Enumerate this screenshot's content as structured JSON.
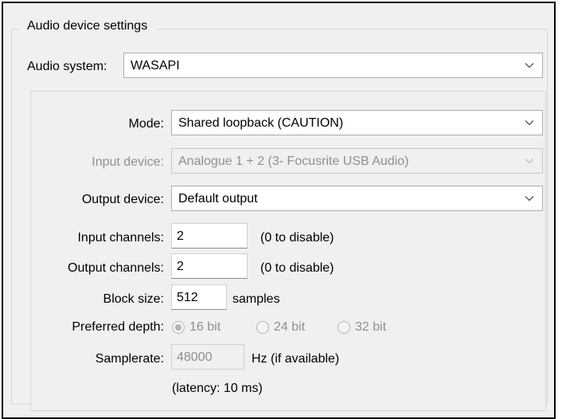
{
  "group_title": "Audio device settings",
  "audio_system": {
    "label": "Audio system:",
    "value": "WASAPI"
  },
  "mode": {
    "label": "Mode:",
    "value": "Shared loopback (CAUTION)"
  },
  "input_device": {
    "label": "Input device:",
    "value": "Analogue 1 + 2 (3- Focusrite USB Audio)"
  },
  "output_device": {
    "label": "Output device:",
    "value": "Default output"
  },
  "input_channels": {
    "label": "Input channels:",
    "value": "2",
    "hint": "(0 to disable)"
  },
  "output_channels": {
    "label": "Output channels:",
    "value": "2",
    "hint": "(0 to disable)"
  },
  "block_size": {
    "label": "Block size:",
    "value": "512",
    "unit": "samples"
  },
  "preferred_depth": {
    "label": "Preferred depth:",
    "options": [
      "16 bit",
      "24 bit",
      "32 bit"
    ],
    "selected": "16 bit"
  },
  "samplerate": {
    "label": "Samplerate:",
    "value": "48000",
    "unit": "Hz (if available)"
  },
  "latency": "(latency: 10 ms)",
  "colors": {
    "disabled_text": "#8f8f8f",
    "dialog_bg": "#f0f0f0",
    "border": "#adadad"
  },
  "icons": {
    "dropdown": "chevron-down-icon"
  }
}
